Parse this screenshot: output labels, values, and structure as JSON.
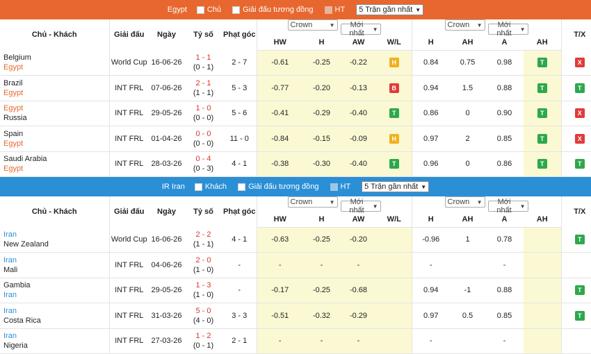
{
  "sections": [
    {
      "filter": {
        "team": "Egypt",
        "home_label": "Chủ",
        "same_league_label": "Giải đấu tương đồng",
        "ht_label": "HT",
        "recent": "5 Trận gần nhất"
      },
      "headers": {
        "teams": "Chủ - Khách",
        "league": "Giải đấu",
        "date": "Ngày",
        "score": "Tỷ số",
        "corners": "Phạt góc",
        "tx": "T/X",
        "odds1": {
          "book": "Crown",
          "time": "Mới nhất",
          "hw": "HW",
          "h": "H",
          "aw": "AW",
          "wl": "W/L"
        },
        "odds2": {
          "book": "Crown",
          "time": "Mới nhất",
          "h": "H",
          "ah": "AH",
          "a": "A",
          "ah2": "AH"
        }
      },
      "rows": [
        {
          "home": "Belgium",
          "away": "Egypt",
          "highlight": "away",
          "league": "World Cup",
          "date": "16-06-26",
          "ft": "1 - 1",
          "ht": "(0 - 1)",
          "corners": "2 - 7",
          "hw": "-0.61",
          "h": "-0.25",
          "aw": "-0.22",
          "wl": "H",
          "ah_h": "0.84",
          "ah": "0.75",
          "ah_a": "0.98",
          "ah_res": "T",
          "tx": "X"
        },
        {
          "home": "Brazil",
          "away": "Egypt",
          "highlight": "away",
          "league": "INT FRL",
          "date": "07-06-26",
          "ft": "2 - 1",
          "ht": "(1 - 1)",
          "corners": "5 - 3",
          "hw": "-0.77",
          "h": "-0.20",
          "aw": "-0.13",
          "wl": "B",
          "ah_h": "0.94",
          "ah": "1.5",
          "ah_a": "0.88",
          "ah_res": "T",
          "tx": "T"
        },
        {
          "home": "Egypt",
          "away": "Russia",
          "highlight": "home",
          "league": "INT FRL",
          "date": "29-05-26",
          "ft": "1 - 0",
          "ht": "(0 - 0)",
          "corners": "5 - 6",
          "hw": "-0.41",
          "h": "-0.29",
          "aw": "-0.40",
          "wl": "T",
          "ah_h": "0.86",
          "ah": "0",
          "ah_a": "0.90",
          "ah_res": "T",
          "tx": "X"
        },
        {
          "home": "Spain",
          "away": "Egypt",
          "highlight": "away",
          "league": "INT FRL",
          "date": "01-04-26",
          "ft": "0 - 0",
          "ht": "(0 - 0)",
          "corners": "11 - 0",
          "hw": "-0.84",
          "h": "-0.15",
          "aw": "-0.09",
          "wl": "H",
          "ah_h": "0.97",
          "ah": "2",
          "ah_a": "0.85",
          "ah_res": "T",
          "tx": "X"
        },
        {
          "home": "Saudi Arabia",
          "away": "Egypt",
          "highlight": "away",
          "league": "INT FRL",
          "date": "28-03-26",
          "ft": "0 - 4",
          "ht": "(0 - 3)",
          "corners": "4 - 1",
          "hw": "-0.38",
          "h": "-0.30",
          "aw": "-0.40",
          "wl": "T",
          "ah_h": "0.96",
          "ah": "0",
          "ah_a": "0.86",
          "ah_res": "T",
          "tx": "T"
        }
      ]
    },
    {
      "filter": {
        "team": "IR Iran",
        "home_label": "Khách",
        "same_league_label": "Giải đấu tương đồng",
        "ht_label": "HT",
        "recent": "5 Trận gần nhất"
      },
      "headers": {
        "teams": "Chủ - Khách",
        "league": "Giải đấu",
        "date": "Ngày",
        "score": "Tỷ số",
        "corners": "Phạt góc",
        "tx": "T/X",
        "odds1": {
          "book": "Crown",
          "time": "Mới nhất",
          "hw": "HW",
          "h": "H",
          "aw": "AW",
          "wl": "W/L"
        },
        "odds2": {
          "book": "Crown",
          "time": "Mới nhất",
          "h": "H",
          "ah": "AH",
          "a": "A",
          "ah2": "AH"
        }
      },
      "rows": [
        {
          "home": "Iran",
          "away": "New Zealand",
          "highlight": "home",
          "league": "World Cup",
          "date": "16-06-26",
          "ft": "2 - 2",
          "ht": "(1 - 1)",
          "corners": "4 - 1",
          "hw": "-0.63",
          "h": "-0.25",
          "aw": "-0.20",
          "wl": "",
          "ah_h": "-0.96",
          "ah": "1",
          "ah_a": "0.78",
          "ah_res": "",
          "tx": "T"
        },
        {
          "home": "Iran",
          "away": "Mali",
          "highlight": "home",
          "league": "INT FRL",
          "date": "04-06-26",
          "ft": "2 - 0",
          "ht": "(1 - 0)",
          "corners": "-",
          "hw": "-",
          "h": "-",
          "aw": "-",
          "wl": "",
          "ah_h": "-",
          "ah": "",
          "ah_a": "-",
          "ah_res": "",
          "tx": ""
        },
        {
          "home": "Gambia",
          "away": "Iran",
          "highlight": "away",
          "league": "INT FRL",
          "date": "29-05-26",
          "ft": "1 - 3",
          "ht": "(1 - 0)",
          "corners": "-",
          "hw": "-0.17",
          "h": "-0.25",
          "aw": "-0.68",
          "wl": "",
          "ah_h": "0.94",
          "ah": "-1",
          "ah_a": "0.88",
          "ah_res": "",
          "tx": "T"
        },
        {
          "home": "Iran",
          "away": "Costa Rica",
          "highlight": "home",
          "league": "INT FRL",
          "date": "31-03-26",
          "ft": "5 - 0",
          "ht": "(4 - 0)",
          "corners": "3 - 3",
          "hw": "-0.51",
          "h": "-0.32",
          "aw": "-0.29",
          "wl": "",
          "ah_h": "0.97",
          "ah": "0.5",
          "ah_a": "0.85",
          "ah_res": "",
          "tx": "T"
        },
        {
          "home": "Iran",
          "away": "Nigeria",
          "highlight": "home",
          "league": "INT FRL",
          "date": "27-03-26",
          "ft": "1 - 2",
          "ht": "(0 - 1)",
          "corners": "2 - 1",
          "hw": "-",
          "h": "-",
          "aw": "-",
          "wl": "",
          "ah_h": "-",
          "ah": "",
          "ah_a": "-",
          "ah_res": "",
          "tx": ""
        }
      ]
    }
  ],
  "colors": {
    "orange": "#e8672e",
    "blue": "#2b8fd6",
    "green": "#2ea84c",
    "red": "#e03b3b",
    "yellow": "#f2b01e",
    "highlight": "#fbf9d4"
  }
}
